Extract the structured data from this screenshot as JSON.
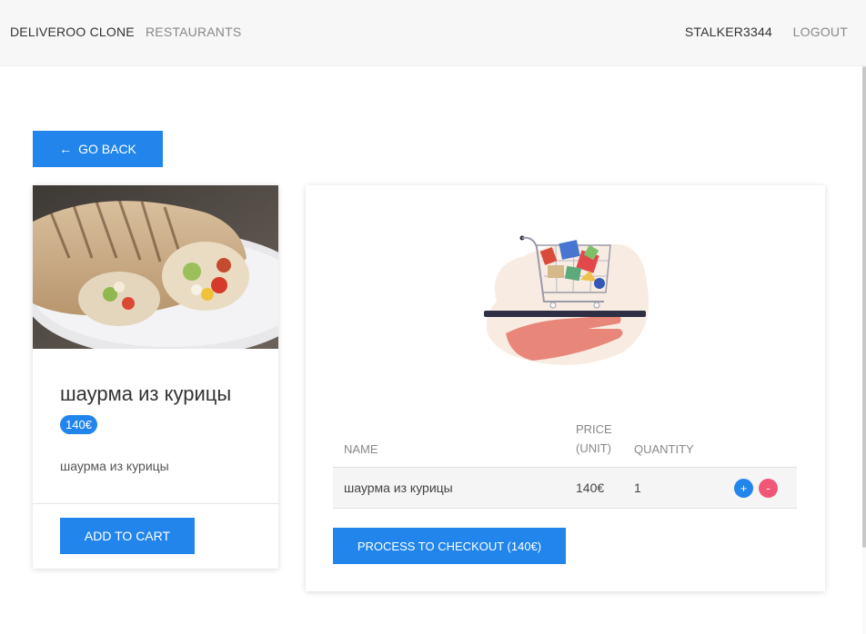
{
  "navbar": {
    "brand": "DELIVEROO CLONE",
    "restaurants_link": "RESTAURANTS",
    "username": "STALKER3344",
    "logout": "LOGOUT"
  },
  "go_back_label": "GO BACK",
  "dish": {
    "title": "шаурма из курицы",
    "price": "140€",
    "description": "шаурма из курицы",
    "add_to_cart_label": "ADD TO CART"
  },
  "cart": {
    "headers": {
      "name": "NAME",
      "price": "PRICE (UNIT)",
      "quantity": "QUANTITY"
    },
    "items": [
      {
        "name": "шаурма из курицы",
        "price": "140€",
        "quantity": "1"
      }
    ],
    "plus_label": "+",
    "minus_label": "-",
    "checkout_label": "PROCESS TO CHECKOUT (140€)"
  },
  "colors": {
    "primary": "#2185ec",
    "danger": "#ef5777",
    "navbar_bg": "#f7f7f7"
  }
}
